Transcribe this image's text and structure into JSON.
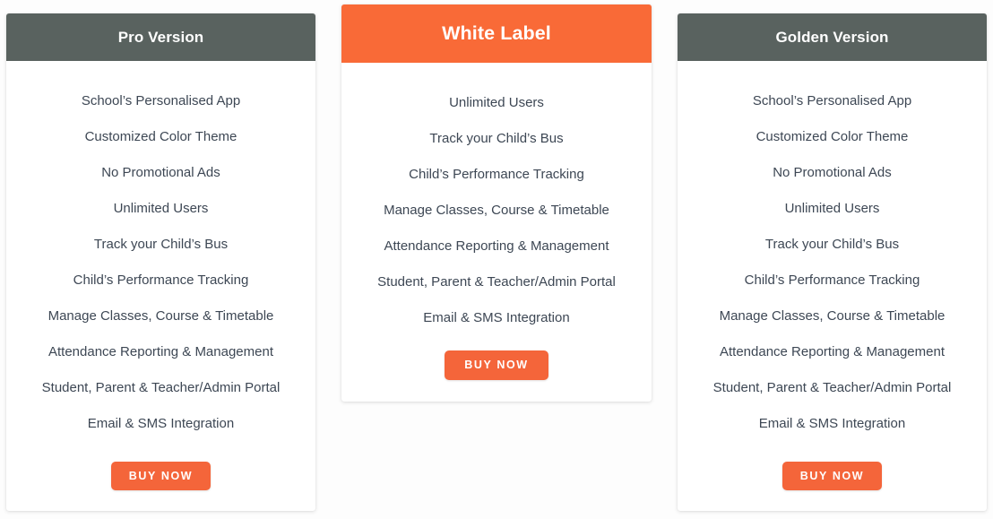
{
  "theme": {
    "dark_header_color": "#59625f",
    "accent_color": "#f96a37",
    "button_color": "#f4653a",
    "text_color": "#3d4754",
    "card_background": "#ffffff",
    "page_background": "#fdfdfd"
  },
  "plans": [
    {
      "id": "pro",
      "title": "Pro Version",
      "features": [
        "School’s Personalised App",
        "Customized Color Theme",
        "No Promotional Ads",
        "Unlimited Users",
        "Track your Child’s Bus",
        "Child’s Performance Tracking",
        "Manage Classes, Course & Timetable",
        "Attendance Reporting & Management",
        "Student, Parent & Teacher/Admin Portal",
        "Email & SMS Integration"
      ],
      "cta_label": "BUY NOW"
    },
    {
      "id": "white-label",
      "title": "White Label",
      "features": [
        "Unlimited Users",
        "Track your Child’s Bus",
        "Child’s Performance Tracking",
        "Manage Classes, Course & Timetable",
        "Attendance Reporting & Management",
        "Student, Parent & Teacher/Admin Portal",
        "Email & SMS Integration"
      ],
      "cta_label": "BUY NOW"
    },
    {
      "id": "golden",
      "title": "Golden Version",
      "features": [
        "School’s Personalised App",
        "Customized Color Theme",
        "No Promotional Ads",
        "Unlimited Users",
        "Track your Child’s Bus",
        "Child’s Performance Tracking",
        "Manage Classes, Course & Timetable",
        "Attendance Reporting & Management",
        "Student, Parent & Teacher/Admin Portal",
        "Email & SMS Integration"
      ],
      "cta_label": "BUY NOW"
    }
  ]
}
